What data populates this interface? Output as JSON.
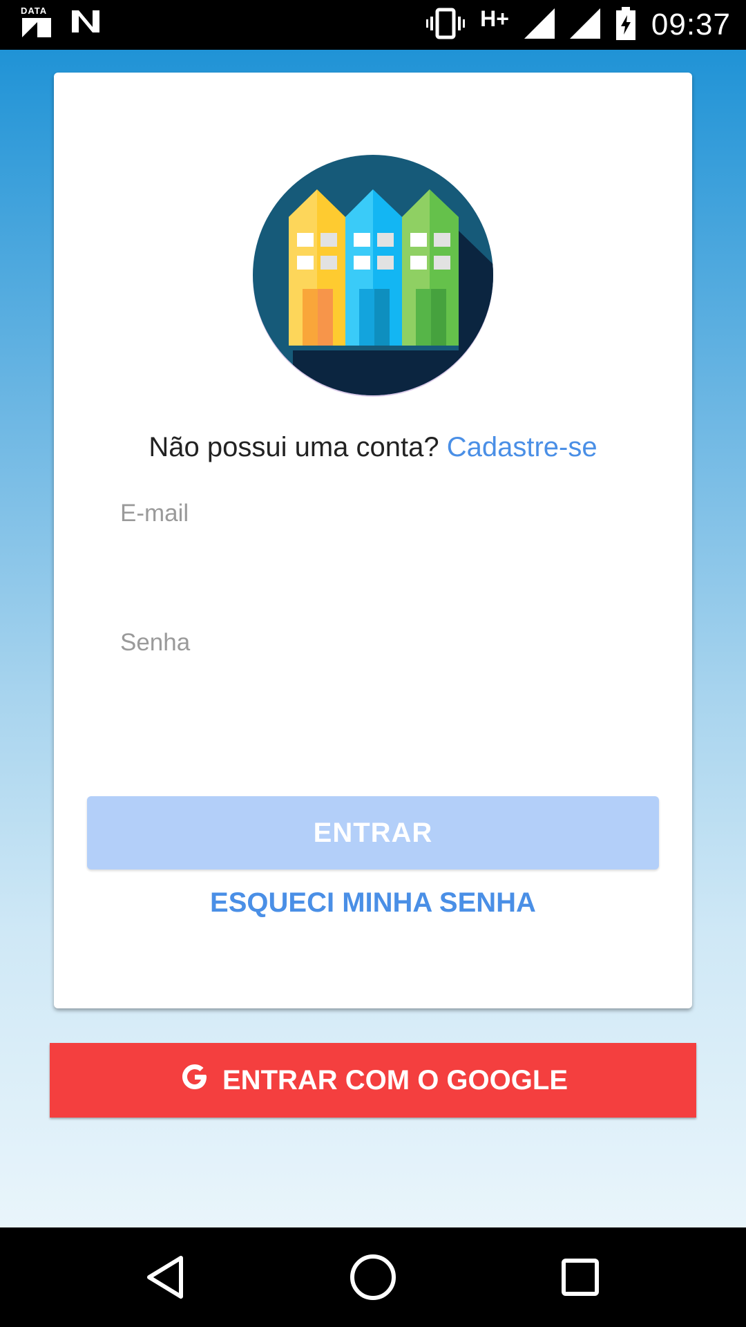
{
  "status_bar": {
    "data_label": "DATA",
    "network": "H+",
    "time": "09:37"
  },
  "login": {
    "signup_prompt": "Não possui uma conta?",
    "signup_link": "Cadastre-se",
    "email_placeholder": "E-mail",
    "password_placeholder": "Senha",
    "login_button": "ENTRAR",
    "forgot_button": "ESQUECI MINHA SENHA",
    "google_button": "ENTRAR COM O GOOGLE"
  },
  "colors": {
    "accent": "#4a8fe6",
    "login_button_bg": "#b3cff9",
    "google_button_bg": "#f43f3f"
  },
  "icons": [
    "data-icon",
    "n-notification-icon",
    "vibrate-icon",
    "signal-icon",
    "battery-icon",
    "app-logo-buildings",
    "google-g-icon",
    "back-icon",
    "home-icon",
    "recents-icon"
  ]
}
